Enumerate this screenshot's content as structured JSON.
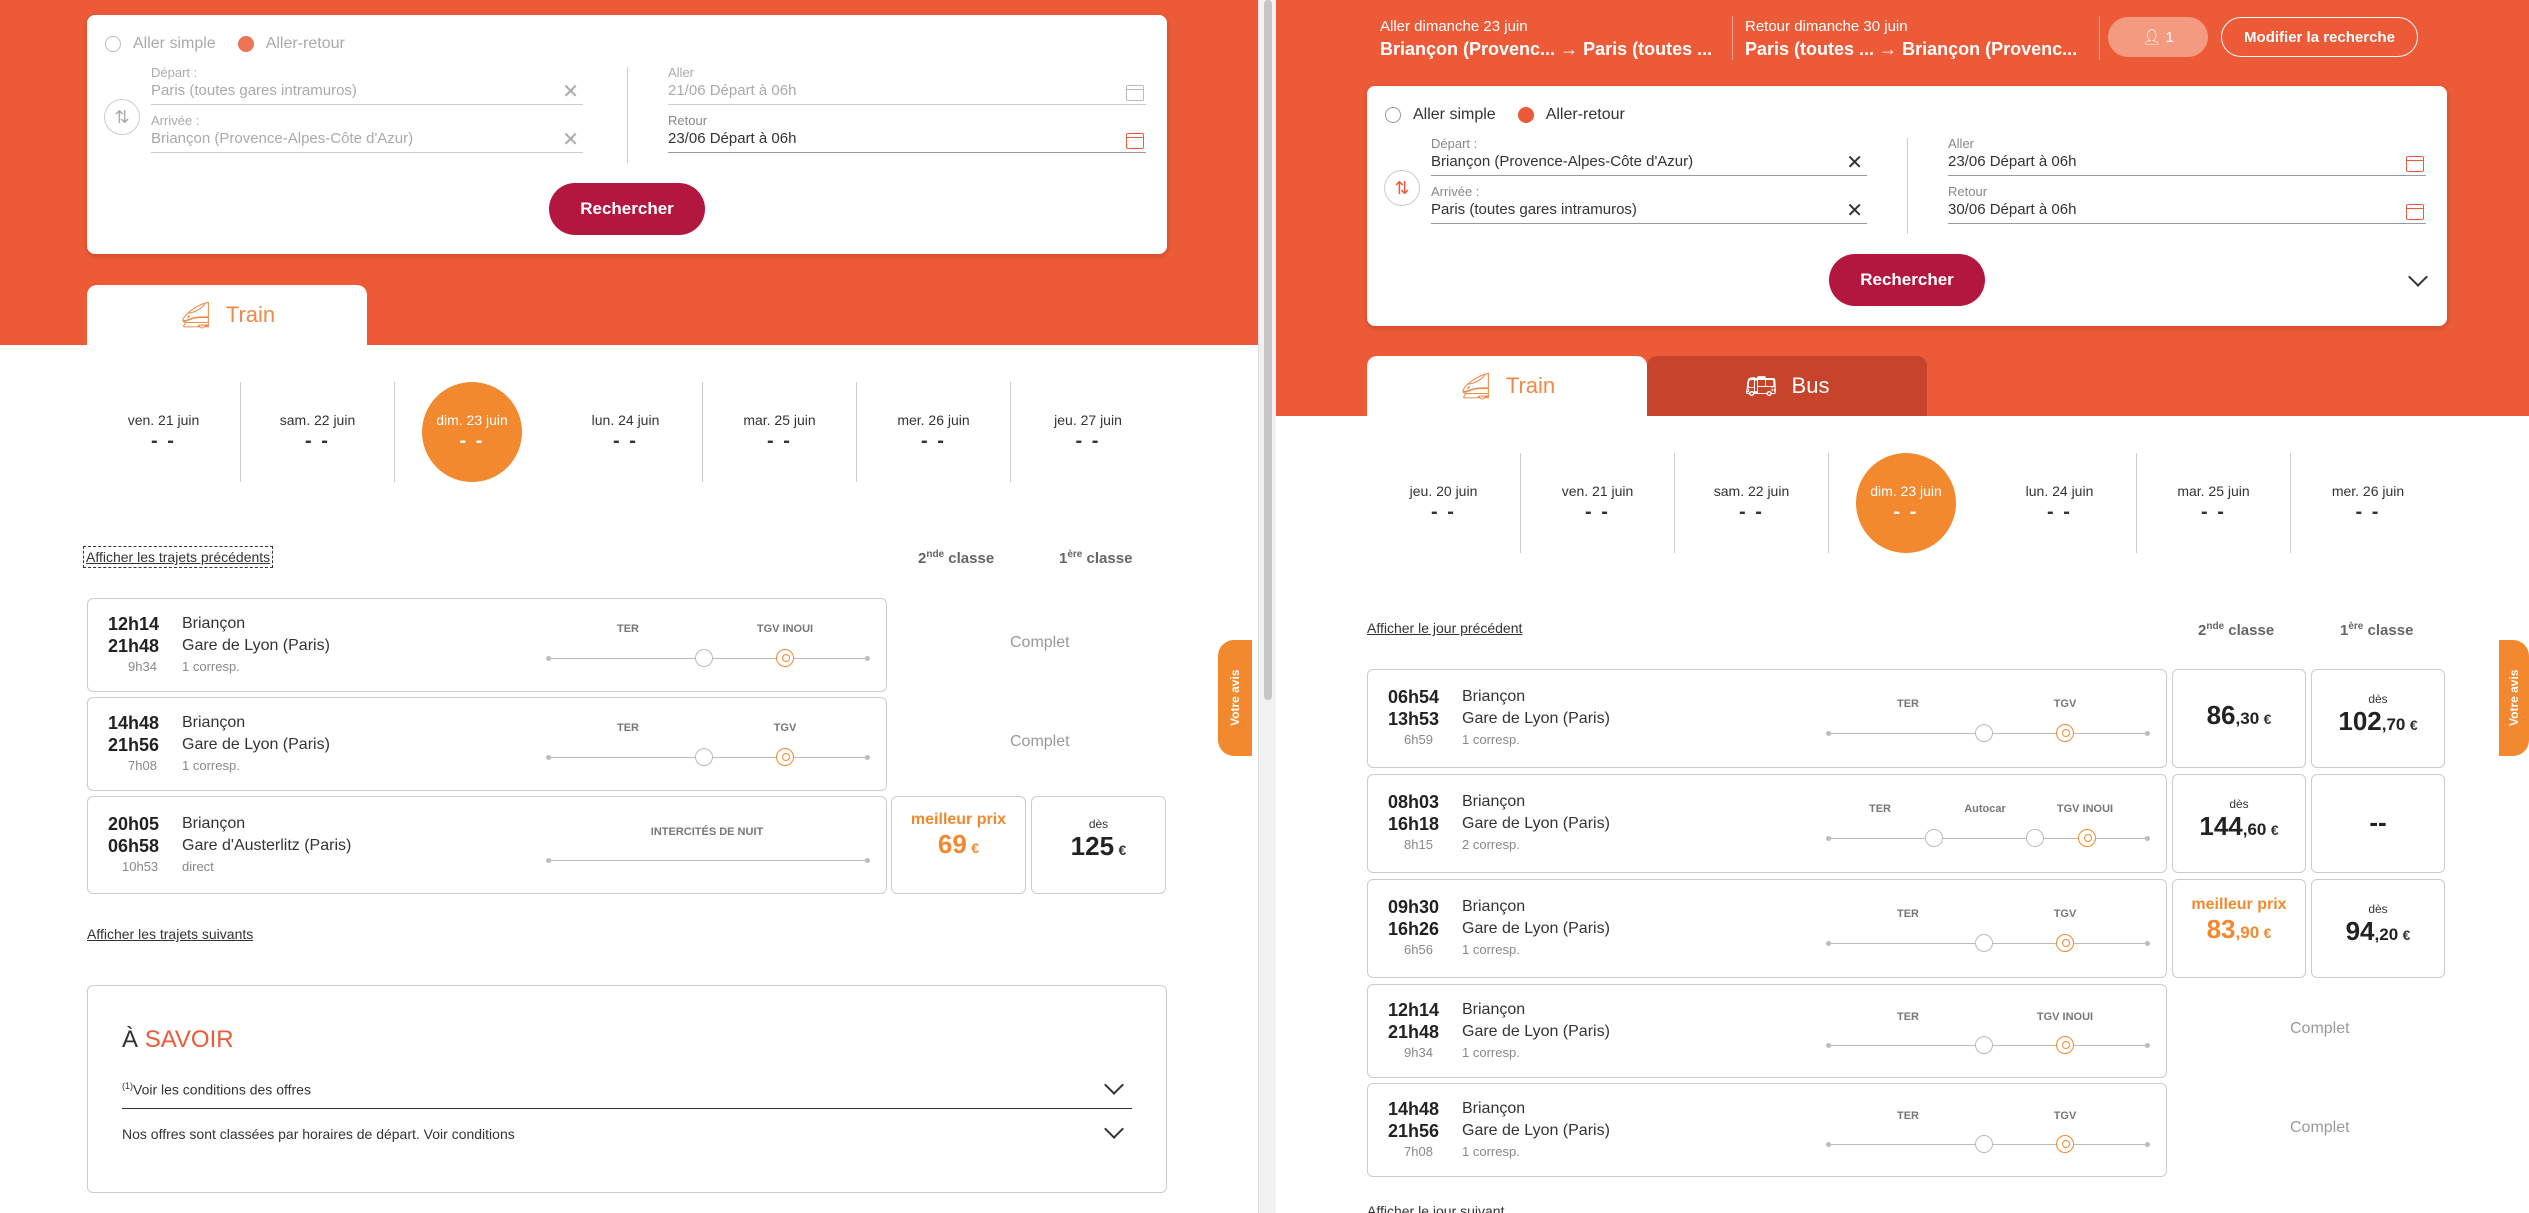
{
  "left": {
    "search": {
      "radio_oneway": "Aller simple",
      "radio_return": "Aller-retour",
      "depart_label": "Départ :",
      "depart_value": "Paris (toutes gares intramuros)",
      "arrivee_label": "Arrivée :",
      "arrivee_value": "Briançon (Provence-Alpes-Côte d'Azur)",
      "aller_label": "Aller",
      "aller_value": "21/06 Départ à 06h",
      "retour_label": "Retour",
      "retour_value": "23/06 Départ à 06h",
      "button": "Rechercher"
    },
    "tab_train": "Train",
    "dates": [
      {
        "label": "ven. 21 juin",
        "price": "- -"
      },
      {
        "label": "sam. 22 juin",
        "price": "- -"
      },
      {
        "label": "dim. 23 juin",
        "price": "- -"
      },
      {
        "label": "lun. 24 juin",
        "price": "- -"
      },
      {
        "label": "mar. 25 juin",
        "price": "- -"
      },
      {
        "label": "mer. 26 juin",
        "price": "- -"
      },
      {
        "label": "jeu. 27 juin",
        "price": "- -"
      }
    ],
    "prev_link": "Afficher les trajets précédents",
    "class2_prefix": "2",
    "class2_sup": "nde",
    "class2_suffix": " classe",
    "class1_prefix": "1",
    "class1_sup": "ère",
    "class1_suffix": " classe",
    "trips": [
      {
        "dep": "12h14",
        "arr": "21h48",
        "dur": "9h34",
        "from": "Briançon",
        "to": "Gare de Lyon (Paris)",
        "corresp": "1 corresp.",
        "seg1": "TER",
        "seg2": "TGV INOUI",
        "status": "Complet"
      },
      {
        "dep": "14h48",
        "arr": "21h56",
        "dur": "7h08",
        "from": "Briançon",
        "to": "Gare de Lyon (Paris)",
        "corresp": "1 corresp.",
        "seg1": "TER",
        "seg2": "TGV",
        "status": "Complet"
      },
      {
        "dep": "20h05",
        "arr": "06h58",
        "dur": "10h53",
        "from": "Briançon",
        "to": "Gare d'Austerlitz (Paris)",
        "corresp": "direct",
        "seg1": "INTERCITÉS DE NUIT",
        "best_label": "meilleur prix",
        "price2": "69",
        "price2_cur": "€",
        "des": "dès",
        "price1": "125",
        "price1_cur": "€"
      }
    ],
    "next_link": "Afficher les trajets suivants",
    "info_title_a": "À ",
    "info_title_b": "SAVOIR",
    "info_row1_sup": "(1)",
    "info_row1": "Voir les conditions des offres",
    "info_row2": "Nos offres sont classées par horaires de départ. Voir conditions",
    "feedback": "Votre avis"
  },
  "right": {
    "header": {
      "aller_title": "Aller dimanche 23 juin",
      "aller_from": "Briançon (Provenc...",
      "aller_to": "Paris (toutes ...",
      "retour_title": "Retour dimanche 30 juin",
      "retour_from": "Paris (toutes ...",
      "retour_to": "Briançon (Provenc...",
      "passengers": "1",
      "modify": "Modifier la recherche"
    },
    "search": {
      "radio_oneway": "Aller simple",
      "radio_return": "Aller-retour",
      "depart_label": "Départ :",
      "depart_value": "Briançon (Provence-Alpes-Côte d'Azur)",
      "arrivee_label": "Arrivée :",
      "arrivee_value": "Paris (toutes gares intramuros)",
      "aller_label": "Aller",
      "aller_value": "23/06 Départ à 06h",
      "retour_label": "Retour",
      "retour_value": "30/06 Départ à 06h",
      "button": "Rechercher"
    },
    "tab_train": "Train",
    "tab_bus": "Bus",
    "dates": [
      {
        "label": "jeu. 20 juin",
        "price": "- -"
      },
      {
        "label": "ven. 21 juin",
        "price": "- -"
      },
      {
        "label": "sam. 22 juin",
        "price": "- -"
      },
      {
        "label": "dim. 23 juin",
        "price": "- -"
      },
      {
        "label": "lun. 24 juin",
        "price": "- -"
      },
      {
        "label": "mar. 25 juin",
        "price": "- -"
      },
      {
        "label": "mer. 26 juin",
        "price": "- -"
      }
    ],
    "prev_link": "Afficher le jour précédent",
    "trips": [
      {
        "dep": "06h54",
        "arr": "13h53",
        "dur": "6h59",
        "from": "Briançon",
        "to": "Gare de Lyon (Paris)",
        "corresp": "1 corresp.",
        "seg1": "TER",
        "seg2": "TGV",
        "p2_int": "86",
        "p2_dec": ",30",
        "p2_cur": "€",
        "p1_des": "dès",
        "p1_int": "102",
        "p1_dec": ",70",
        "p1_cur": "€"
      },
      {
        "dep": "08h03",
        "arr": "16h18",
        "dur": "8h15",
        "from": "Briançon",
        "to": "Gare de Lyon (Paris)",
        "corresp": "2 corresp.",
        "seg1": "TER",
        "seg2": "Autocar",
        "seg3": "TGV INOUI",
        "p2_des": "dès",
        "p2_int": "144",
        "p2_dec": ",60",
        "p2_cur": "€",
        "p1_none": "--"
      },
      {
        "dep": "09h30",
        "arr": "16h26",
        "dur": "6h56",
        "from": "Briançon",
        "to": "Gare de Lyon (Paris)",
        "corresp": "1 corresp.",
        "seg1": "TER",
        "seg2": "TGV",
        "best_label": "meilleur prix",
        "p2_int": "83",
        "p2_dec": ",90",
        "p2_cur": "€",
        "p1_des": "dès",
        "p1_int": "94",
        "p1_dec": ",20",
        "p1_cur": "€"
      },
      {
        "dep": "12h14",
        "arr": "21h48",
        "dur": "9h34",
        "from": "Briançon",
        "to": "Gare de Lyon (Paris)",
        "corresp": "1 corresp.",
        "seg1": "TER",
        "seg2": "TGV INOUI",
        "status": "Complet"
      },
      {
        "dep": "14h48",
        "arr": "21h56",
        "dur": "7h08",
        "from": "Briançon",
        "to": "Gare de Lyon (Paris)",
        "corresp": "1 corresp.",
        "seg1": "TER",
        "seg2": "TGV",
        "status": "Complet"
      }
    ],
    "next_link_partial": "Afficher le jour suivant",
    "feedback": "Votre avis"
  },
  "colors": {
    "brand": "#ec5a37",
    "accent": "#f2892e",
    "button": "#b3173f"
  }
}
